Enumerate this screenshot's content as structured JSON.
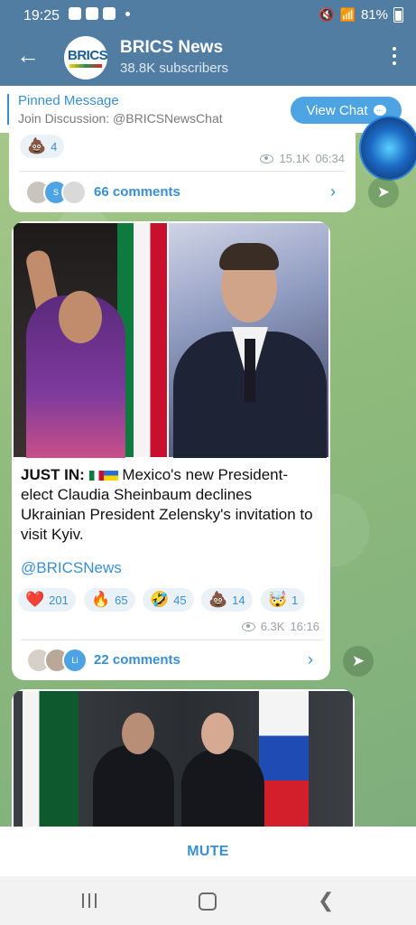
{
  "status_bar": {
    "time": "19:25",
    "battery": "81%"
  },
  "header": {
    "back_icon": "arrow-left-icon",
    "avatar_text": "BRICS",
    "title": "BRICS News",
    "subtitle": "38.8K subscribers"
  },
  "pinned": {
    "label": "Pinned Message",
    "text": "Join Discussion: @BRICSNewsChat",
    "button": "View Chat"
  },
  "post1": {
    "reaction": {
      "emoji": "💩",
      "count": "4"
    },
    "views": "15.1K",
    "time": "06:34",
    "comments": "66 comments",
    "avatar_letter": "S"
  },
  "post2": {
    "headline_prefix": "JUST IN:",
    "headline": "Mexico's new President-elect Claudia Sheinbaum declines Ukrainian President Zelensky's invitation to visit Kyiv.",
    "tag": "@BRICSNews",
    "reactions": [
      {
        "emoji": "❤️",
        "count": "201"
      },
      {
        "emoji": "🔥",
        "count": "65"
      },
      {
        "emoji": "🤣",
        "count": "45"
      },
      {
        "emoji": "💩",
        "count": "14"
      },
      {
        "emoji": "🤯",
        "count": "1"
      }
    ],
    "views": "6.3K",
    "time": "16:16",
    "comments": "22 comments",
    "avatar_letter": "Li"
  },
  "bottom": {
    "mute": "MUTE"
  }
}
